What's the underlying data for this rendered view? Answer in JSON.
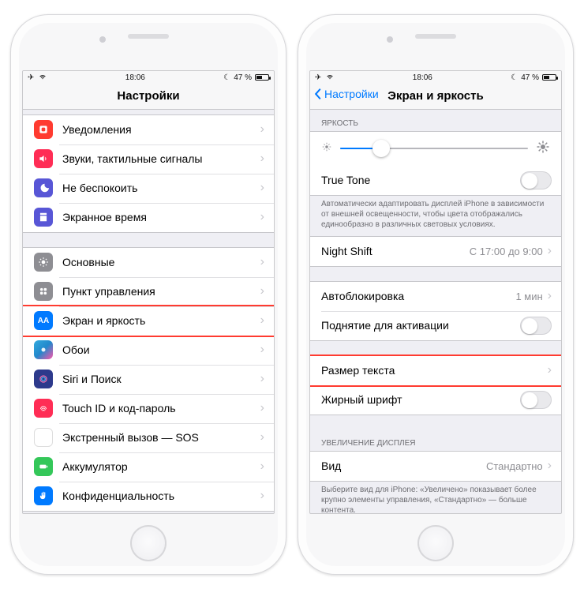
{
  "status": {
    "time": "18:06",
    "battery_text": "47 %"
  },
  "left": {
    "title": "Настройки",
    "group1": [
      {
        "label": "Уведомления"
      },
      {
        "label": "Звуки, тактильные сигналы"
      },
      {
        "label": "Не беспокоить"
      },
      {
        "label": "Экранное время"
      }
    ],
    "group2": [
      {
        "label": "Основные"
      },
      {
        "label": "Пункт управления"
      },
      {
        "label": "Экран и яркость"
      },
      {
        "label": "Обои"
      },
      {
        "label": "Siri и Поиск"
      },
      {
        "label": "Touch ID и код-пароль"
      },
      {
        "label": "Экстренный вызов — SOS"
      },
      {
        "label": "Аккумулятор"
      },
      {
        "label": "Конфиденциальность"
      }
    ]
  },
  "right": {
    "back": "Настройки",
    "title": "Экран и яркость",
    "brightness_header": "ЯРКОСТЬ",
    "true_tone": "True Tone",
    "true_tone_footer": "Автоматически адаптировать дисплей iPhone в зависимости от внешней освещенности, чтобы цвета отображались единообразно в различных световых условиях.",
    "night_shift": {
      "label": "Night Shift",
      "value": "С 17:00 до 9:00"
    },
    "autolock": {
      "label": "Автоблокировка",
      "value": "1 мин"
    },
    "raise": "Поднятие для активации",
    "text_size": "Размер текста",
    "bold": "Жирный шрифт",
    "zoom_header": "УВЕЛИЧЕНИЕ ДИСПЛЕЯ",
    "view": {
      "label": "Вид",
      "value": "Стандартно"
    },
    "zoom_footer": "Выберите вид для iPhone: «Увеличено» показывает более крупно элементы управления, «Стандартно» — больше контента."
  }
}
